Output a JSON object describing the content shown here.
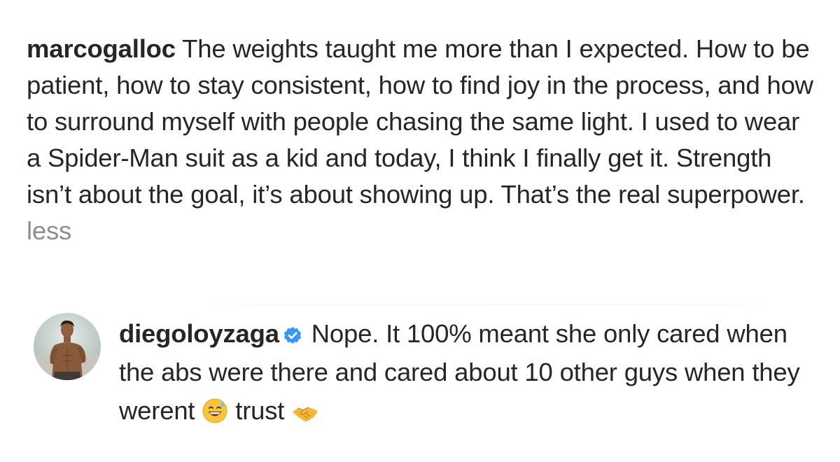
{
  "post_caption": {
    "username": "marcogalloc",
    "text": "The weights taught me more than I expected. How to be patient, how to stay consistent, how to find joy in the process, and how to surround myself with people chasing the same light. I used to wear a Spider-Man suit as a kid and today, I think I finally get it. Strength isn’t about the goal, it’s about showing up. That’s the real superpower.",
    "less_label": "less"
  },
  "comment": {
    "username": "diegoloyzaga",
    "verified": true,
    "text": "Nope. It 100% meant she only cared when the abs were there and cared about 10 other guys when they werent",
    "after_emoji_text": "trust",
    "emojis": [
      "grinning-sweat-face-emoji",
      "handshake-emoji"
    ]
  },
  "colors": {
    "text": "#262626",
    "muted": "#8e8e8e",
    "verified_blue": "#3897f0"
  }
}
